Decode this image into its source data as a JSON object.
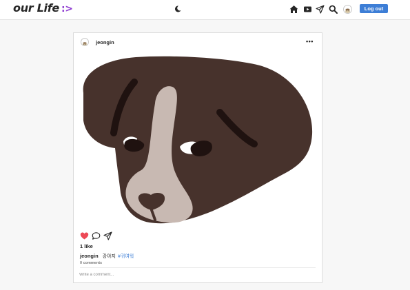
{
  "header": {
    "logo_text": "our Life",
    "logo_mark": ":>",
    "logout_label": "Log out"
  },
  "icons": {
    "theme": "moon-icon",
    "home": "home-icon",
    "video": "video-icon",
    "direct": "paper-plane-icon",
    "search": "search-icon"
  },
  "post": {
    "username": "jeongin",
    "more": "•••",
    "image_alt": "dog illustration",
    "likes": "1 like",
    "caption_user": "jeongin",
    "caption_text": "강아지",
    "caption_hashtag": "#귀여워",
    "comments_count": "0 comments",
    "comment_placeholder": "Write a comment..."
  },
  "colors": {
    "accent": "#3d7ed6",
    "logo_mark": "#8e3bd1",
    "heart": "#ed4956",
    "dog_dark": "#47322c",
    "dog_light": "#c8b9b2",
    "dog_stripe": "#1f1210"
  }
}
